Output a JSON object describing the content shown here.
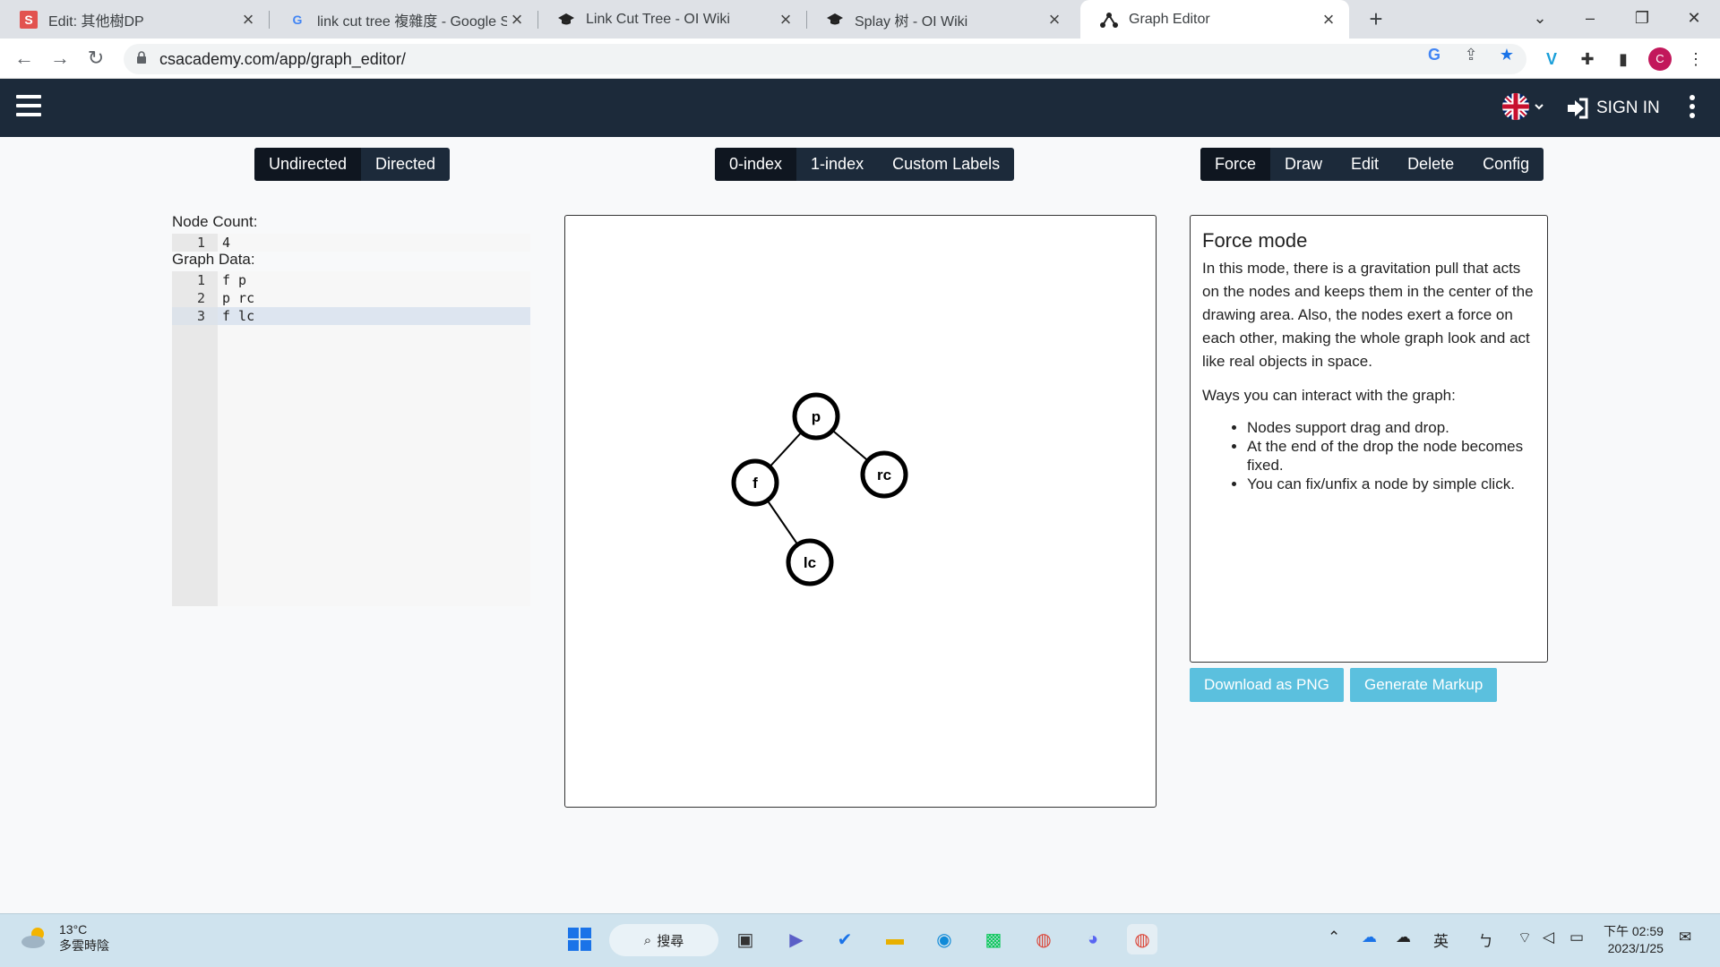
{
  "browser": {
    "tabs": [
      {
        "title": "Edit: 其他樹DP",
        "favicon": "S"
      },
      {
        "title": "link cut tree 複雜度 - Google Se",
        "favicon": "G"
      },
      {
        "title": "Link Cut Tree - OI Wiki",
        "favicon": "mortarboard-icon"
      },
      {
        "title": "Splay 树 - OI Wiki",
        "favicon": "mortarboard-icon"
      },
      {
        "title": "Graph Editor",
        "favicon": "graph-icon"
      }
    ],
    "url": "csacademy.com/app/graph_editor/"
  },
  "header": {
    "sign_in": "SIGN IN"
  },
  "toolbar": {
    "direction": [
      "Undirected",
      "Directed"
    ],
    "indexing": [
      "0-index",
      "1-index",
      "Custom Labels"
    ],
    "modes": [
      "Force",
      "Draw",
      "Edit",
      "Delete",
      "Config"
    ]
  },
  "editor": {
    "node_count_label": "Node Count:",
    "node_count_value": "4",
    "graph_data_label": "Graph Data:",
    "graph_lines": [
      "f p",
      "p rc",
      "f lc"
    ],
    "line_numbers": [
      "1",
      "2",
      "3"
    ]
  },
  "graph": {
    "nodes": [
      {
        "id": "p",
        "label": "p"
      },
      {
        "id": "f",
        "label": "f"
      },
      {
        "id": "rc",
        "label": "rc"
      },
      {
        "id": "lc",
        "label": "lc"
      }
    ],
    "edges": [
      [
        "f",
        "p"
      ],
      [
        "p",
        "rc"
      ],
      [
        "f",
        "lc"
      ]
    ]
  },
  "info": {
    "title": "Force mode",
    "description": "In this mode, there is a gravitation pull that acts on the nodes and keeps them in the center of the drawing area. Also, the nodes exert a force on each other, making the whole graph look and act like real objects in space.",
    "ways_title": "Ways you can interact with the graph:",
    "tips": [
      "Nodes support drag and drop.",
      "At the end of the drop the node becomes fixed.",
      "You can fix/unfix a node by simple click."
    ],
    "download_label": "Download as PNG",
    "markup_label": "Generate Markup"
  },
  "taskbar": {
    "temperature": "13°C",
    "weather_text": "多雲時陰",
    "search_label": "搜尋",
    "ime": "英",
    "ime2": "ㄅ",
    "time": "下午 02:59",
    "date": "2023/1/25"
  },
  "colors": {
    "header_bg": "#1c2a3a",
    "button_active": "#0f1620",
    "download_button": "#5bc0de"
  }
}
